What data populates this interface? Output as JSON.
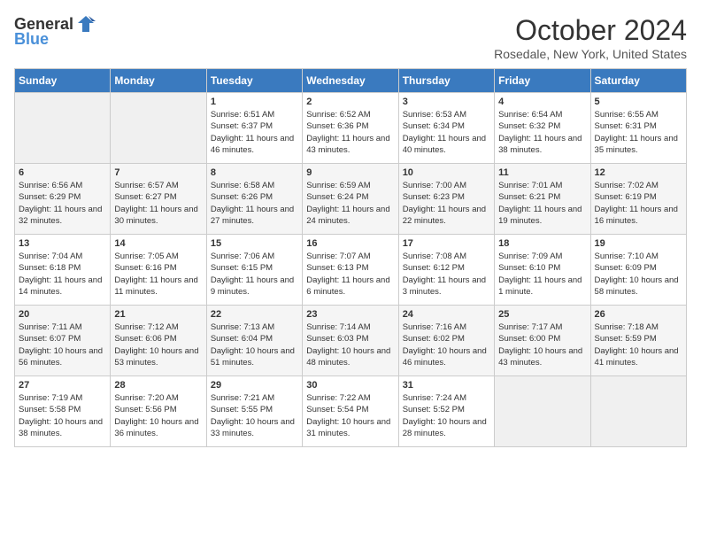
{
  "header": {
    "logo_general": "General",
    "logo_blue": "Blue",
    "title": "October 2024",
    "location": "Rosedale, New York, United States"
  },
  "days_of_week": [
    "Sunday",
    "Monday",
    "Tuesday",
    "Wednesday",
    "Thursday",
    "Friday",
    "Saturday"
  ],
  "weeks": [
    [
      {
        "num": "",
        "sunrise": "",
        "sunset": "",
        "daylight": "",
        "empty": true
      },
      {
        "num": "",
        "sunrise": "",
        "sunset": "",
        "daylight": "",
        "empty": true
      },
      {
        "num": "1",
        "sunrise": "Sunrise: 6:51 AM",
        "sunset": "Sunset: 6:37 PM",
        "daylight": "Daylight: 11 hours and 46 minutes."
      },
      {
        "num": "2",
        "sunrise": "Sunrise: 6:52 AM",
        "sunset": "Sunset: 6:36 PM",
        "daylight": "Daylight: 11 hours and 43 minutes."
      },
      {
        "num": "3",
        "sunrise": "Sunrise: 6:53 AM",
        "sunset": "Sunset: 6:34 PM",
        "daylight": "Daylight: 11 hours and 40 minutes."
      },
      {
        "num": "4",
        "sunrise": "Sunrise: 6:54 AM",
        "sunset": "Sunset: 6:32 PM",
        "daylight": "Daylight: 11 hours and 38 minutes."
      },
      {
        "num": "5",
        "sunrise": "Sunrise: 6:55 AM",
        "sunset": "Sunset: 6:31 PM",
        "daylight": "Daylight: 11 hours and 35 minutes."
      }
    ],
    [
      {
        "num": "6",
        "sunrise": "Sunrise: 6:56 AM",
        "sunset": "Sunset: 6:29 PM",
        "daylight": "Daylight: 11 hours and 32 minutes."
      },
      {
        "num": "7",
        "sunrise": "Sunrise: 6:57 AM",
        "sunset": "Sunset: 6:27 PM",
        "daylight": "Daylight: 11 hours and 30 minutes."
      },
      {
        "num": "8",
        "sunrise": "Sunrise: 6:58 AM",
        "sunset": "Sunset: 6:26 PM",
        "daylight": "Daylight: 11 hours and 27 minutes."
      },
      {
        "num": "9",
        "sunrise": "Sunrise: 6:59 AM",
        "sunset": "Sunset: 6:24 PM",
        "daylight": "Daylight: 11 hours and 24 minutes."
      },
      {
        "num": "10",
        "sunrise": "Sunrise: 7:00 AM",
        "sunset": "Sunset: 6:23 PM",
        "daylight": "Daylight: 11 hours and 22 minutes."
      },
      {
        "num": "11",
        "sunrise": "Sunrise: 7:01 AM",
        "sunset": "Sunset: 6:21 PM",
        "daylight": "Daylight: 11 hours and 19 minutes."
      },
      {
        "num": "12",
        "sunrise": "Sunrise: 7:02 AM",
        "sunset": "Sunset: 6:19 PM",
        "daylight": "Daylight: 11 hours and 16 minutes."
      }
    ],
    [
      {
        "num": "13",
        "sunrise": "Sunrise: 7:04 AM",
        "sunset": "Sunset: 6:18 PM",
        "daylight": "Daylight: 11 hours and 14 minutes."
      },
      {
        "num": "14",
        "sunrise": "Sunrise: 7:05 AM",
        "sunset": "Sunset: 6:16 PM",
        "daylight": "Daylight: 11 hours and 11 minutes."
      },
      {
        "num": "15",
        "sunrise": "Sunrise: 7:06 AM",
        "sunset": "Sunset: 6:15 PM",
        "daylight": "Daylight: 11 hours and 9 minutes."
      },
      {
        "num": "16",
        "sunrise": "Sunrise: 7:07 AM",
        "sunset": "Sunset: 6:13 PM",
        "daylight": "Daylight: 11 hours and 6 minutes."
      },
      {
        "num": "17",
        "sunrise": "Sunrise: 7:08 AM",
        "sunset": "Sunset: 6:12 PM",
        "daylight": "Daylight: 11 hours and 3 minutes."
      },
      {
        "num": "18",
        "sunrise": "Sunrise: 7:09 AM",
        "sunset": "Sunset: 6:10 PM",
        "daylight": "Daylight: 11 hours and 1 minute."
      },
      {
        "num": "19",
        "sunrise": "Sunrise: 7:10 AM",
        "sunset": "Sunset: 6:09 PM",
        "daylight": "Daylight: 10 hours and 58 minutes."
      }
    ],
    [
      {
        "num": "20",
        "sunrise": "Sunrise: 7:11 AM",
        "sunset": "Sunset: 6:07 PM",
        "daylight": "Daylight: 10 hours and 56 minutes."
      },
      {
        "num": "21",
        "sunrise": "Sunrise: 7:12 AM",
        "sunset": "Sunset: 6:06 PM",
        "daylight": "Daylight: 10 hours and 53 minutes."
      },
      {
        "num": "22",
        "sunrise": "Sunrise: 7:13 AM",
        "sunset": "Sunset: 6:04 PM",
        "daylight": "Daylight: 10 hours and 51 minutes."
      },
      {
        "num": "23",
        "sunrise": "Sunrise: 7:14 AM",
        "sunset": "Sunset: 6:03 PM",
        "daylight": "Daylight: 10 hours and 48 minutes."
      },
      {
        "num": "24",
        "sunrise": "Sunrise: 7:16 AM",
        "sunset": "Sunset: 6:02 PM",
        "daylight": "Daylight: 10 hours and 46 minutes."
      },
      {
        "num": "25",
        "sunrise": "Sunrise: 7:17 AM",
        "sunset": "Sunset: 6:00 PM",
        "daylight": "Daylight: 10 hours and 43 minutes."
      },
      {
        "num": "26",
        "sunrise": "Sunrise: 7:18 AM",
        "sunset": "Sunset: 5:59 PM",
        "daylight": "Daylight: 10 hours and 41 minutes."
      }
    ],
    [
      {
        "num": "27",
        "sunrise": "Sunrise: 7:19 AM",
        "sunset": "Sunset: 5:58 PM",
        "daylight": "Daylight: 10 hours and 38 minutes."
      },
      {
        "num": "28",
        "sunrise": "Sunrise: 7:20 AM",
        "sunset": "Sunset: 5:56 PM",
        "daylight": "Daylight: 10 hours and 36 minutes."
      },
      {
        "num": "29",
        "sunrise": "Sunrise: 7:21 AM",
        "sunset": "Sunset: 5:55 PM",
        "daylight": "Daylight: 10 hours and 33 minutes."
      },
      {
        "num": "30",
        "sunrise": "Sunrise: 7:22 AM",
        "sunset": "Sunset: 5:54 PM",
        "daylight": "Daylight: 10 hours and 31 minutes."
      },
      {
        "num": "31",
        "sunrise": "Sunrise: 7:24 AM",
        "sunset": "Sunset: 5:52 PM",
        "daylight": "Daylight: 10 hours and 28 minutes."
      },
      {
        "num": "",
        "sunrise": "",
        "sunset": "",
        "daylight": "",
        "empty": true
      },
      {
        "num": "",
        "sunrise": "",
        "sunset": "",
        "daylight": "",
        "empty": true
      }
    ]
  ]
}
